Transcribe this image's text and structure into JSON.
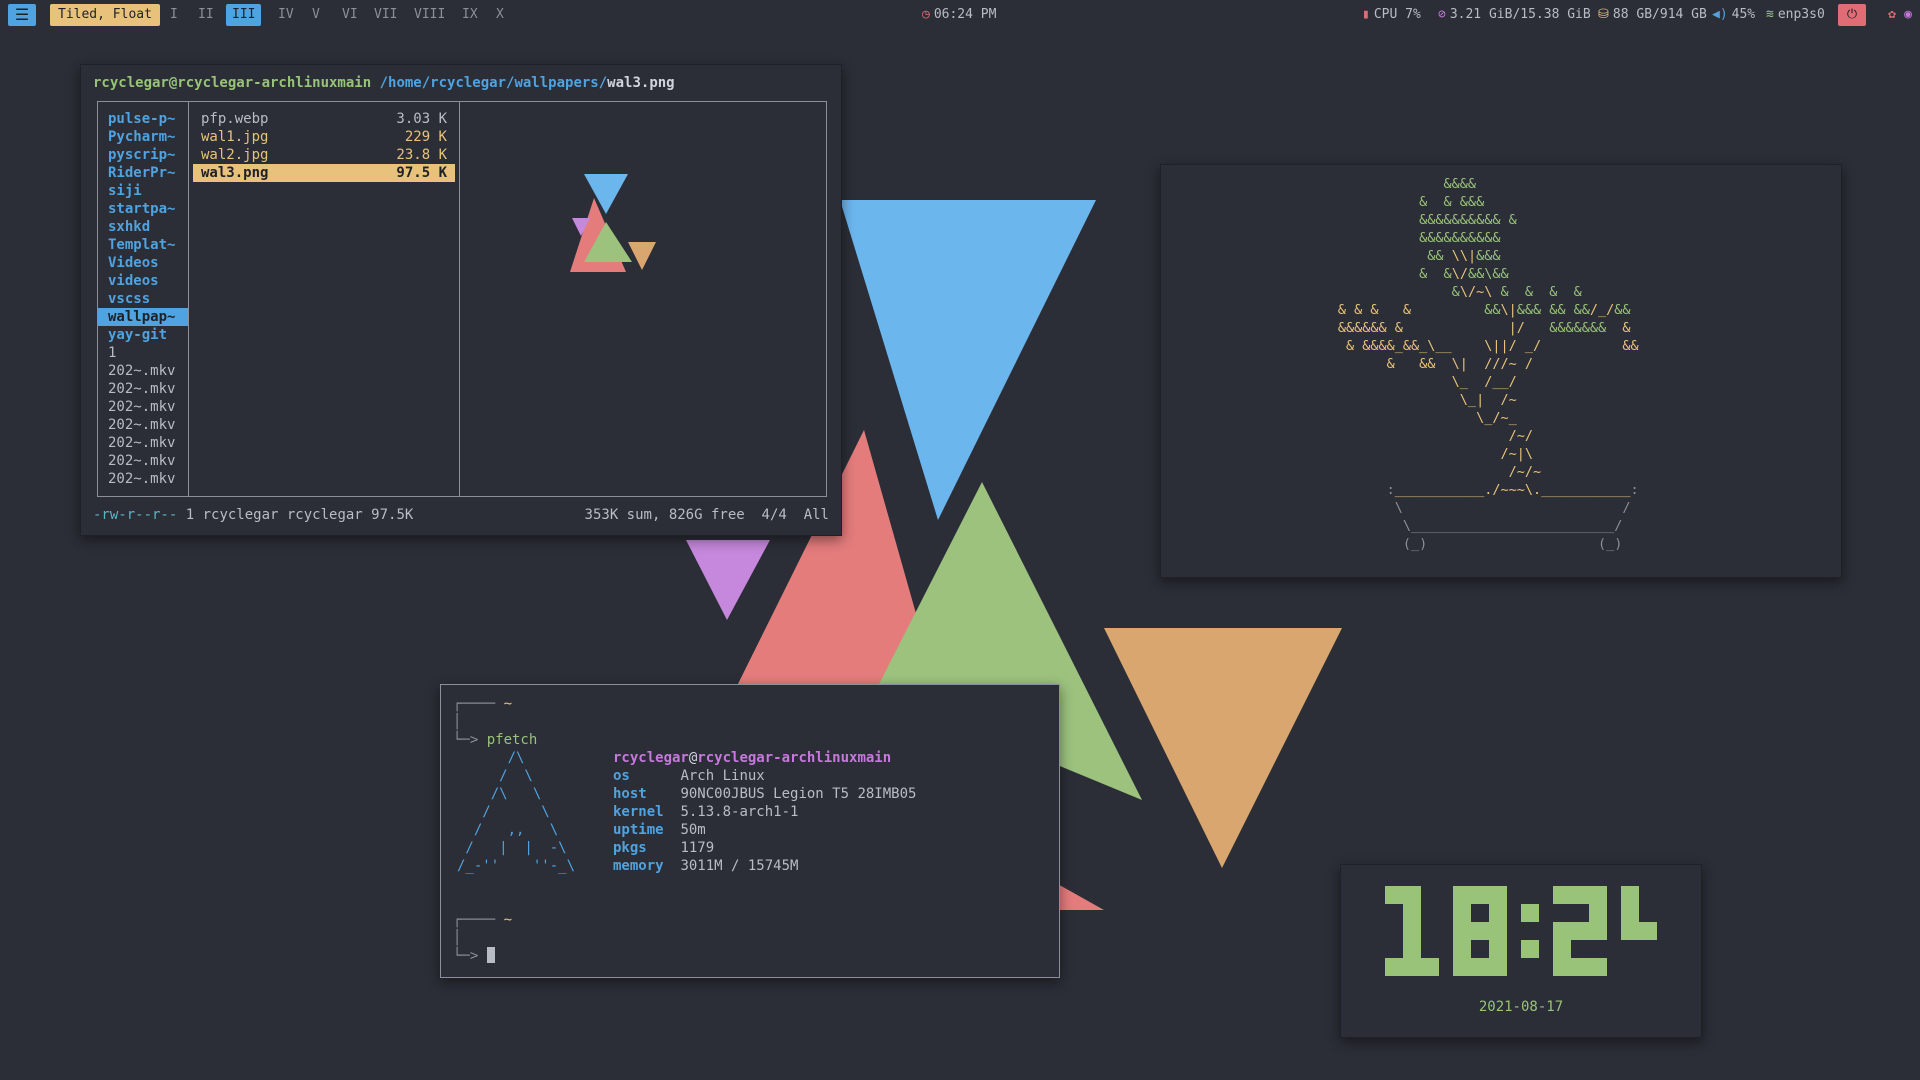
{
  "colors": {
    "background": "#2b2e36",
    "accent_blue": "#4fa3e0",
    "accent_yellow": "#e8c27a",
    "green": "#98c379",
    "red": "#e06c75",
    "purple": "#c678dd",
    "orange": "#d9a66f"
  },
  "bar": {
    "menu_icon": "hamburger-icon",
    "layout": "Tiled, Float",
    "workspaces": [
      "I",
      "II",
      "III",
      "IV",
      "V",
      "VI",
      "VII",
      "VIII",
      "IX",
      "X"
    ],
    "active_workspace": "III",
    "time": "06:24 PM",
    "cpu": "CPU 7%",
    "memory": "3.21 GiB/15.38 GiB",
    "disk": "88 GB/914 GB",
    "volume": "45%",
    "network": "enp3s0"
  },
  "ranger": {
    "user_host": "rcyclegar@rcyclegar-archlinuxmain",
    "path_dir": "/home/rcyclegar/wallpapers/",
    "path_file": "wal3.png",
    "parent_items": [
      "pulse-p~",
      "Pycharm~",
      "pyscrip~",
      "RiderPr~",
      "siji",
      "startpa~",
      "sxhkd",
      "Templat~",
      "Videos",
      "videos",
      "vscss",
      "wallpap~",
      "yay-git",
      "1",
      "202~.mkv",
      "202~.mkv",
      "202~.mkv",
      "202~.mkv",
      "202~.mkv",
      "202~.mkv",
      "202~.mkv"
    ],
    "files": [
      {
        "name": "pfp.webp",
        "size": "3.03 K"
      },
      {
        "name": "wal1.jpg",
        "size": "229 K"
      },
      {
        "name": "wal2.jpg",
        "size": "23.8 K"
      },
      {
        "name": "wal3.png",
        "size": "97.5 K"
      }
    ],
    "permissions": "-rw-r--r--",
    "owner_info": "1 rcyclegar rcyclegar 97.5K",
    "summary": "353K sum, 826G free",
    "position": "4/4",
    "scope": "All"
  },
  "terminal": {
    "prompt_dir": "~",
    "command": "pfetch",
    "user": "rcyclegar",
    "host": "rcyclegar-archlinuxmain",
    "info": [
      {
        "key": "os",
        "value": "Arch Linux"
      },
      {
        "key": "host",
        "value": "90NC00JBUS Legion T5 28IMB05"
      },
      {
        "key": "kernel",
        "value": "5.13.8-arch1-1"
      },
      {
        "key": "uptime",
        "value": "50m"
      },
      {
        "key": "pkgs",
        "value": "1179"
      },
      {
        "key": "memory",
        "value": "3011M / 15745M"
      }
    ]
  },
  "clock": {
    "time": "18:24",
    "date": "2021-08-17"
  }
}
